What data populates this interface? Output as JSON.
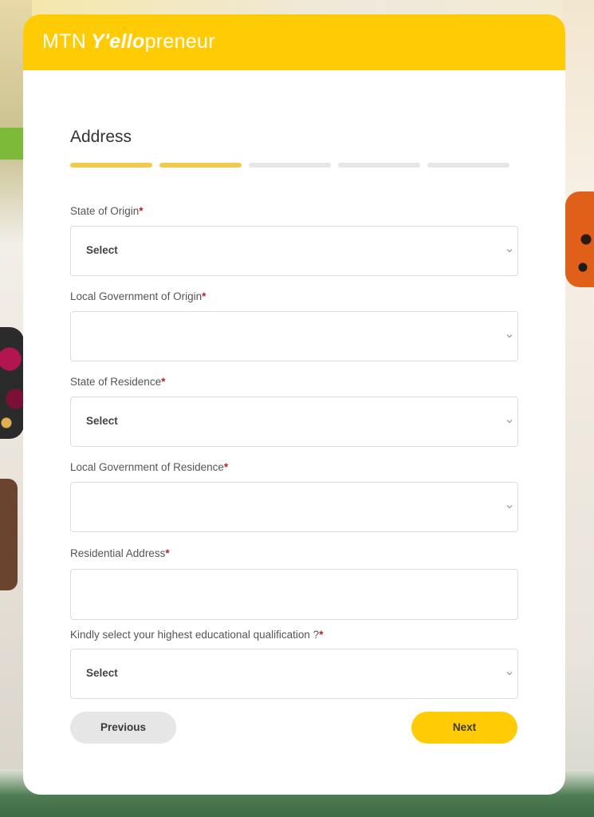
{
  "brand": {
    "name": "MTN",
    "yello": "Y'ello",
    "preneur": "preneur"
  },
  "colors": {
    "accent": "#ffcb05",
    "progress_done": "#f2c94c",
    "progress_todo": "#e6e6e6",
    "required": "#b4232c"
  },
  "form": {
    "section_title": "Address",
    "progress": {
      "steps_total": 5,
      "steps_done": 2
    },
    "fields": {
      "state_origin": {
        "label": "State of Origin",
        "required": "*",
        "value": "Select",
        "type": "select"
      },
      "lga_origin": {
        "label": "Local Government of Origin",
        "required": "*",
        "value": "",
        "type": "select"
      },
      "state_residence": {
        "label": "State of Residence",
        "required": "*",
        "value": "Select",
        "type": "select"
      },
      "lga_residence": {
        "label": "Local Government of Residence",
        "required": "*",
        "value": "",
        "type": "select"
      },
      "address": {
        "label": "Residential Address",
        "required": "*",
        "value": "",
        "type": "text"
      },
      "qualification": {
        "label": "Kindly select your highest educational qualification ?",
        "required": "*",
        "value": "Select",
        "type": "select"
      }
    },
    "buttons": {
      "previous": "Previous",
      "next": "Next"
    },
    "icons": {
      "dropdown": "chevron-down-icon"
    }
  }
}
